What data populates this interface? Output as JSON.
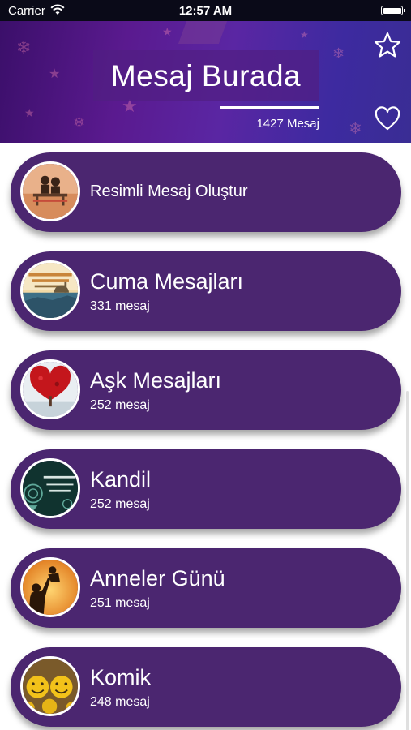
{
  "status_bar": {
    "carrier": "Carrier",
    "time": "12:57 AM"
  },
  "header": {
    "title": "Mesaj Burada",
    "message_count": "1427 Mesaj",
    "gradient_colors": [
      "#3b0f6a",
      "#5a26a3",
      "#3a2d94"
    ],
    "favorite_icon": "star-outline-icon",
    "likes_icon": "heart-outline-icon"
  },
  "colors": {
    "card_background": "#4b2670",
    "text": "#ffffff"
  },
  "categories": [
    {
      "title": "Resimli Mesaj Oluştur",
      "thumbnail": "couple-on-bench-thumbnail"
    },
    {
      "title": "Cuma Mesajları",
      "count": "331 mesaj",
      "thumbnail": "mosque-sunset-thumbnail"
    },
    {
      "title": "Aşk Mesajları",
      "count": "252 mesaj",
      "thumbnail": "heart-tree-thumbnail"
    },
    {
      "title": "Kandil",
      "count": "252 mesaj",
      "thumbnail": "kandil-pattern-thumbnail"
    },
    {
      "title": "Anneler Günü",
      "count": "251 mesaj",
      "thumbnail": "mother-child-silhouette-thumbnail"
    },
    {
      "title": "Komik",
      "count": "248 mesaj",
      "thumbnail": "smiley-faces-thumbnail"
    }
  ]
}
